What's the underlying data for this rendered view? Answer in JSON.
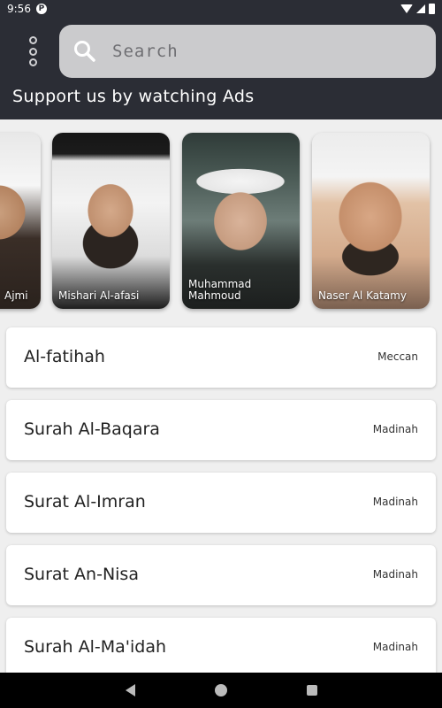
{
  "status_bar": {
    "time": "9:56",
    "app_icon": "P"
  },
  "header": {
    "search_placeholder": "Search",
    "support_text": "Support us by watching Ads"
  },
  "reciters": [
    {
      "name": "Ajmi"
    },
    {
      "name": "Mishari Al-afasi"
    },
    {
      "name": "Muhammad\nMahmoud"
    },
    {
      "name": "Naser Al Katamy"
    }
  ],
  "surahs": [
    {
      "name": "Al-fatihah",
      "type": "Meccan"
    },
    {
      "name": "Surah Al-Baqara",
      "type": "Madinah"
    },
    {
      "name": "Surat Al-Imran",
      "type": "Madinah"
    },
    {
      "name": "Surat An-Nisa",
      "type": "Madinah"
    },
    {
      "name": "Surah Al-Ma'idah",
      "type": "Madinah"
    }
  ],
  "icons": {
    "menu": "more-vertical-icon",
    "search": "search-icon",
    "nav_back": "back-icon",
    "nav_home": "home-icon",
    "nav_recents": "recents-icon"
  }
}
